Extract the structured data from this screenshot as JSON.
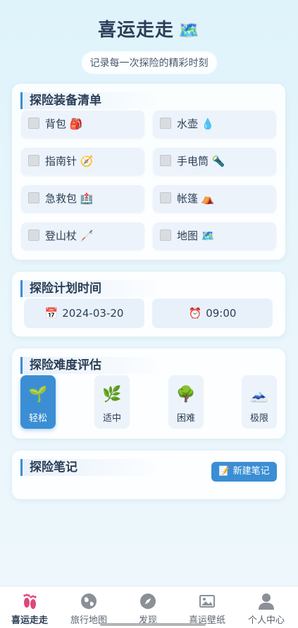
{
  "header": {
    "title": "喜运走走",
    "title_emoji": "🗺️",
    "subtitle": "记录每一次探险的精彩时刻"
  },
  "equipment": {
    "title": "探险装备清单",
    "items": [
      {
        "label": "背包 🎒",
        "checked": false
      },
      {
        "label": "水壶 💧",
        "checked": false
      },
      {
        "label": "指南针 🧭",
        "checked": false
      },
      {
        "label": "手电筒 🔦",
        "checked": false
      },
      {
        "label": "急救包 🏥",
        "checked": false
      },
      {
        "label": "帐篷 ⛺",
        "checked": false
      },
      {
        "label": "登山杖 🦯",
        "checked": false
      },
      {
        "label": "地图 🗺️",
        "checked": false
      }
    ]
  },
  "plan": {
    "title": "探险计划时间",
    "date_icon": "📅",
    "date": "2024-03-20",
    "time_icon": "⏰",
    "time": "09:00"
  },
  "difficulty": {
    "title": "探险难度评估",
    "selected": "轻松",
    "levels": [
      {
        "icon": "🌱",
        "label": "轻松"
      },
      {
        "icon": "🌿",
        "label": "适中"
      },
      {
        "icon": "🌳",
        "label": "困难"
      },
      {
        "icon": "🗻",
        "label": "极限"
      }
    ]
  },
  "notes": {
    "title": "探险笔记",
    "new_button_icon": "📝",
    "new_button": "新建笔记"
  },
  "tabbar": {
    "active": "喜运走走",
    "tabs": [
      {
        "label": "喜运走走",
        "icon": "footprints-icon"
      },
      {
        "label": "旅行地图",
        "icon": "globe-icon"
      },
      {
        "label": "发现",
        "icon": "compass-icon"
      },
      {
        "label": "喜运壁纸",
        "icon": "image-icon"
      },
      {
        "label": "个人中心",
        "icon": "person-icon"
      }
    ]
  },
  "colors": {
    "accent": "#3b8ed4",
    "background": "#e3f4fb",
    "tab_active": "#e0457b"
  }
}
